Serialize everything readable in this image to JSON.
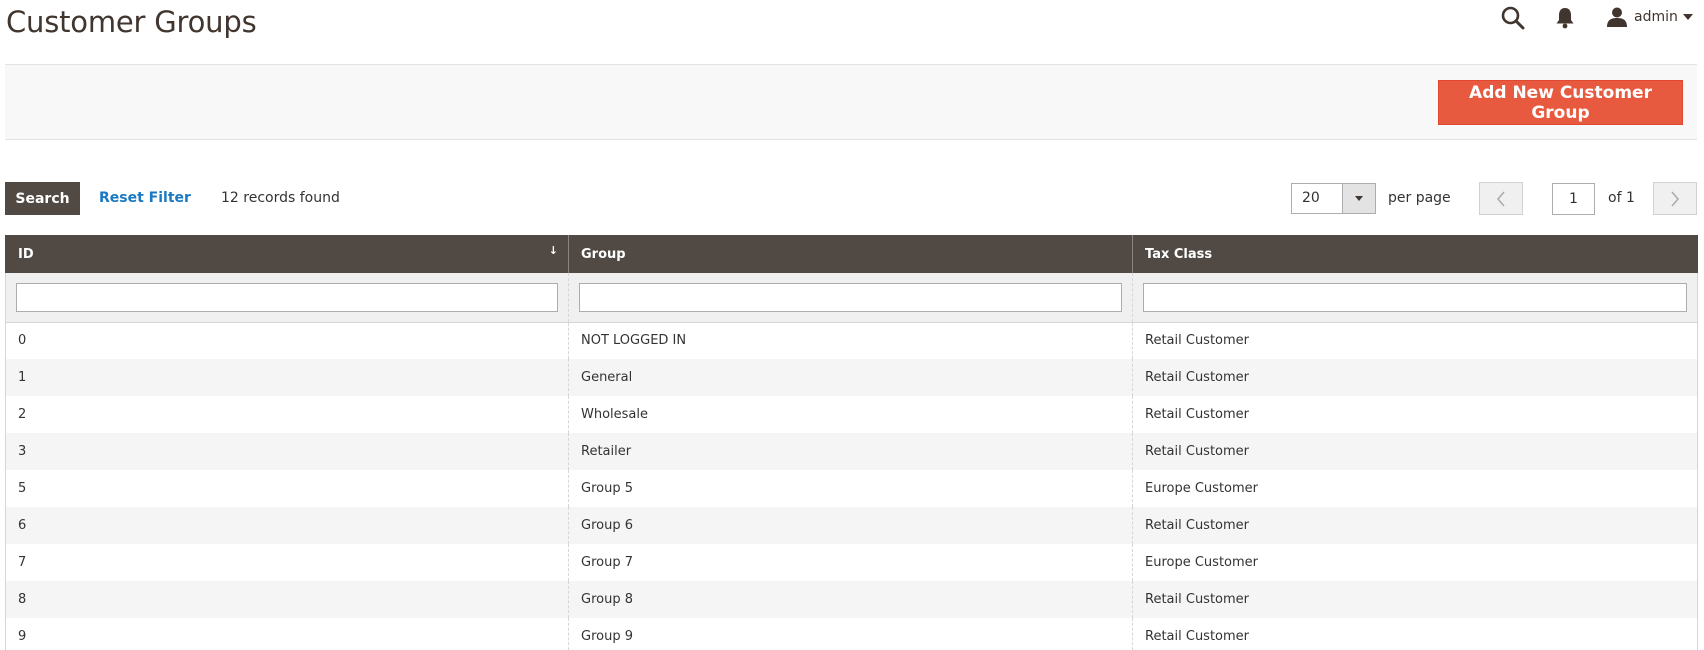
{
  "page": {
    "title": "Customer Groups"
  },
  "header": {
    "user_label": "admin"
  },
  "actions": {
    "add_button_label": "Add New Customer Group"
  },
  "toolbar": {
    "search_label": "Search",
    "reset_filter_label": "Reset Filter",
    "records_found": "12 records found",
    "per_page_value": "20",
    "per_page_label": "per page",
    "current_page": "1",
    "page_of": "of 1"
  },
  "grid": {
    "columns": [
      {
        "label": "ID"
      },
      {
        "label": "Group"
      },
      {
        "label": "Tax Class"
      }
    ],
    "sort_indicator": "↓",
    "rows": [
      {
        "id": "0",
        "group": "NOT LOGGED IN",
        "tax_class": "Retail Customer"
      },
      {
        "id": "1",
        "group": "General",
        "tax_class": "Retail Customer"
      },
      {
        "id": "2",
        "group": "Wholesale",
        "tax_class": "Retail Customer"
      },
      {
        "id": "3",
        "group": "Retailer",
        "tax_class": "Retail Customer"
      },
      {
        "id": "5",
        "group": "Group 5",
        "tax_class": "Europe Customer"
      },
      {
        "id": "6",
        "group": "Group 6",
        "tax_class": "Retail Customer"
      },
      {
        "id": "7",
        "group": "Group 7",
        "tax_class": "Europe Customer"
      },
      {
        "id": "8",
        "group": "Group 8",
        "tax_class": "Retail Customer"
      },
      {
        "id": "9",
        "group": "Group 9",
        "tax_class": "Retail Customer"
      }
    ]
  },
  "icons": {
    "search": "search-icon",
    "notifications": "bell-icon",
    "user": "user-icon",
    "prev": "chevron-left-icon",
    "next": "chevron-right-icon"
  },
  "colors": {
    "primary_button": "#e85a3f",
    "header_bar": "#514943",
    "link": "#1979c3"
  }
}
